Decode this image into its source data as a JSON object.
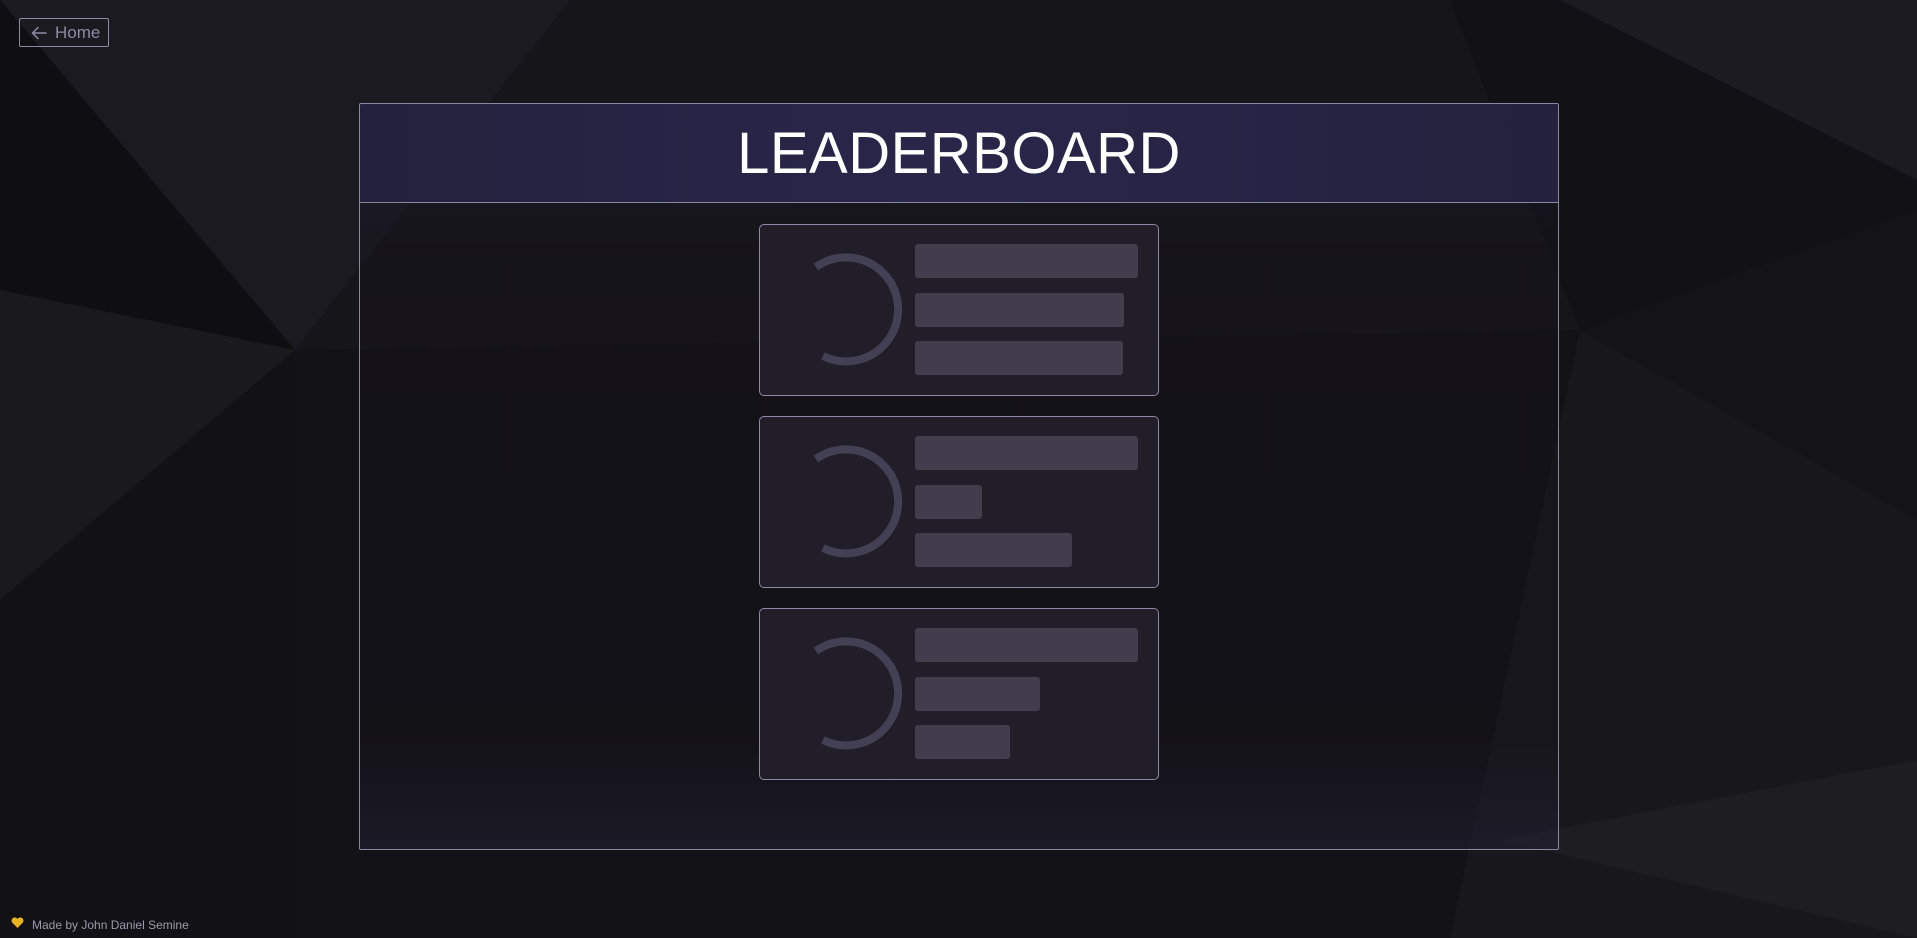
{
  "nav": {
    "home_label": "Home"
  },
  "leaderboard": {
    "title": "LEADERBOARD",
    "loading_cards": [
      {
        "state": "loading",
        "placeholder_line_fill": [
          1.0,
          0.94,
          0.93
        ]
      },
      {
        "state": "loading",
        "placeholder_line_fill": [
          1.0,
          0.3,
          0.7
        ]
      },
      {
        "state": "loading",
        "placeholder_line_fill": [
          1.0,
          0.56,
          0.43
        ]
      }
    ]
  },
  "footer": {
    "icon": "heart-icon",
    "credit": "Made by John Daniel Semine"
  },
  "colors": {
    "background": "#141318",
    "header": "#29264a",
    "card": "#221e29",
    "skeleton": "#423d4c",
    "spinner": "#434055",
    "heart": "#e8b322",
    "border": "#8a86a0"
  }
}
